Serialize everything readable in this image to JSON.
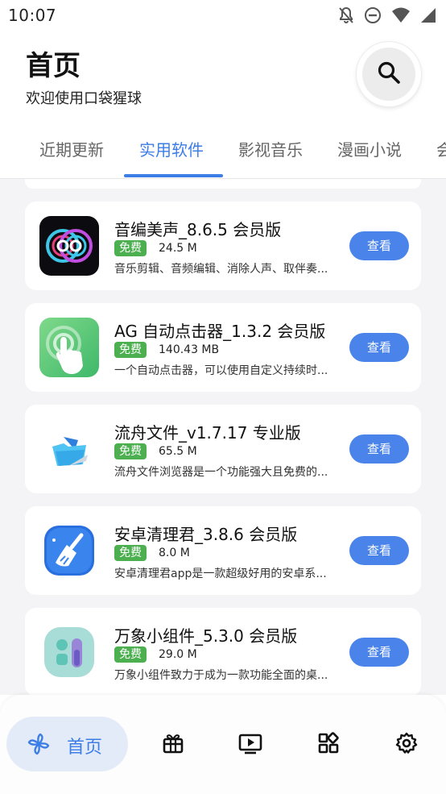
{
  "status_bar": {
    "time": "10:07",
    "icons": [
      "notifications-off-icon",
      "do-not-disturb-icon",
      "wifi-icon",
      "cellular-signal-icon"
    ]
  },
  "header": {
    "title": "首页",
    "subtitle": "欢迎使用口袋猩球",
    "search_icon": "search-icon"
  },
  "tabs": [
    {
      "label": "近期更新",
      "active": false
    },
    {
      "label": "实用软件",
      "active": true
    },
    {
      "label": "影视音乐",
      "active": false
    },
    {
      "label": "漫画小说",
      "active": false
    },
    {
      "label": "会",
      "active": false
    }
  ],
  "apps": [
    {
      "name": "音编美声_8.6.5 会员版",
      "badge": "免费",
      "size": "24.5 M",
      "description": "音乐剪辑、音频编辑、消除人声、取伴奏...",
      "button": "查看",
      "icon": "audio-editor-icon"
    },
    {
      "name": "AG 自动点击器_1.3.2 会员版",
      "badge": "免费",
      "size": "140.43 MB",
      "description": "一个自动点击器，可以使用自定义持续时...",
      "button": "查看",
      "icon": "auto-clicker-icon"
    },
    {
      "name": "流舟文件_v1.7.17 专业版",
      "badge": "免费",
      "size": "65.5 M",
      "description": "流舟文件浏览器是一个功能强大且免费的...",
      "button": "查看",
      "icon": "file-manager-icon"
    },
    {
      "name": "安卓清理君_3.8.6 会员版",
      "badge": "免费",
      "size": "8.0 M",
      "description": "安卓清理君app是一款超级好用的安卓系...",
      "button": "查看",
      "icon": "cleaner-broom-icon"
    },
    {
      "name": "万象小组件_5.3.0 会员版",
      "badge": "免费",
      "size": "29.0 M",
      "description": "万象小组件致力于成为一款功能全面的桌...",
      "button": "查看",
      "icon": "widgets-icon"
    }
  ],
  "bottom_nav": {
    "home_label": "首页",
    "items": [
      "home-pinwheel-icon",
      "gift-box-icon",
      "video-play-icon",
      "apps-grid-icon",
      "settings-gear-icon"
    ]
  },
  "colors": {
    "accent": "#3d7ee6",
    "button": "#4a84ea",
    "badge": "#4caf50",
    "list_background": "#f4f4f6"
  }
}
